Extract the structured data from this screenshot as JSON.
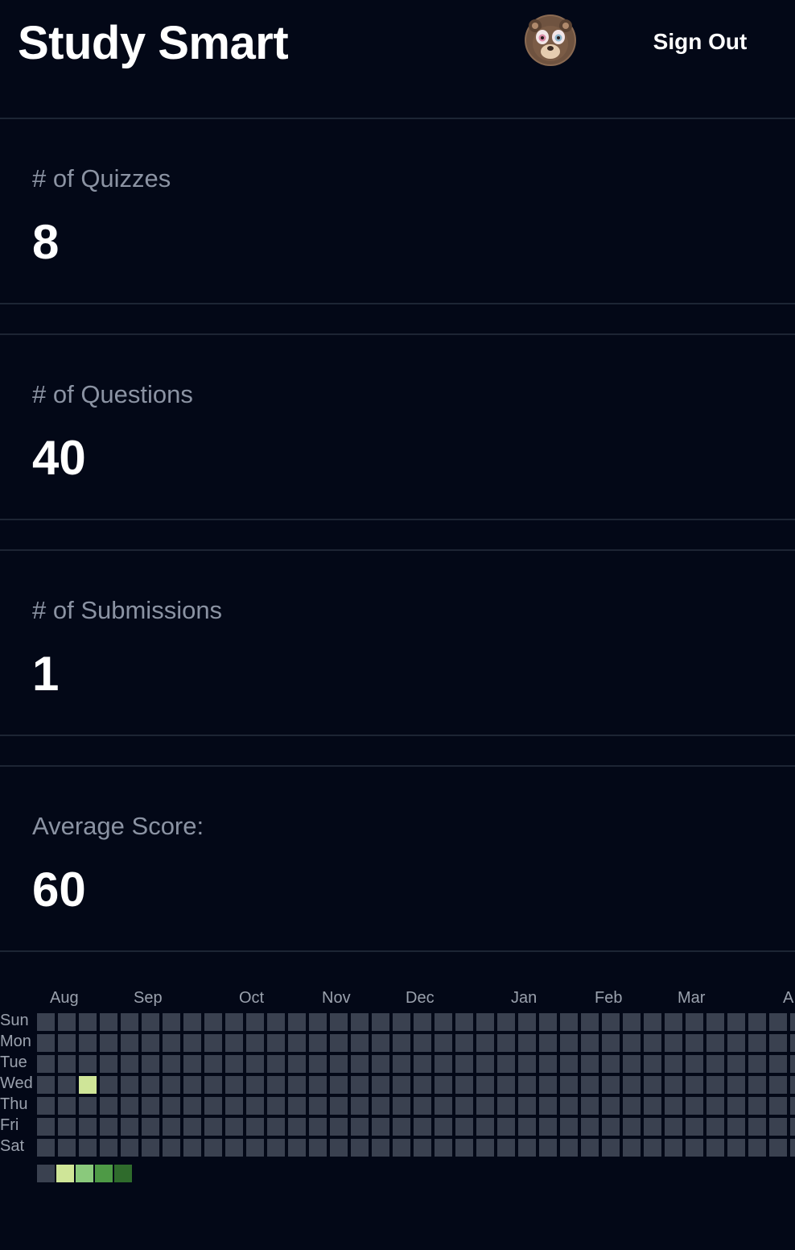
{
  "header": {
    "title": "Study Smart",
    "avatar_alt": "bear avatar",
    "sign_out_label": "Sign Out"
  },
  "stats": [
    {
      "label": "# of Quizzes",
      "value": "8"
    },
    {
      "label": "# of Questions",
      "value": "40"
    },
    {
      "label": "# of Submissions",
      "value": "1"
    },
    {
      "label": "Average Score:",
      "value": "60"
    }
  ],
  "heatmap": {
    "months": [
      "Aug",
      "Sep",
      "Oct",
      "Nov",
      "Dec",
      "Jan",
      "Feb",
      "Mar",
      "A"
    ],
    "days": [
      "Sun",
      "Mon",
      "Tue",
      "Wed",
      "Thu",
      "Fri",
      "Sat"
    ],
    "active_cells": [
      {
        "week": 2,
        "day": 3,
        "level": 1
      }
    ],
    "colors": {
      "empty": "#3a4150",
      "level1": "#cfe598",
      "level2": "#8ac97c",
      "level3": "#4e9a46",
      "level4": "#2f6b2c"
    },
    "legend_levels": [
      "empty",
      "level1",
      "level2",
      "level3",
      "level4"
    ]
  }
}
